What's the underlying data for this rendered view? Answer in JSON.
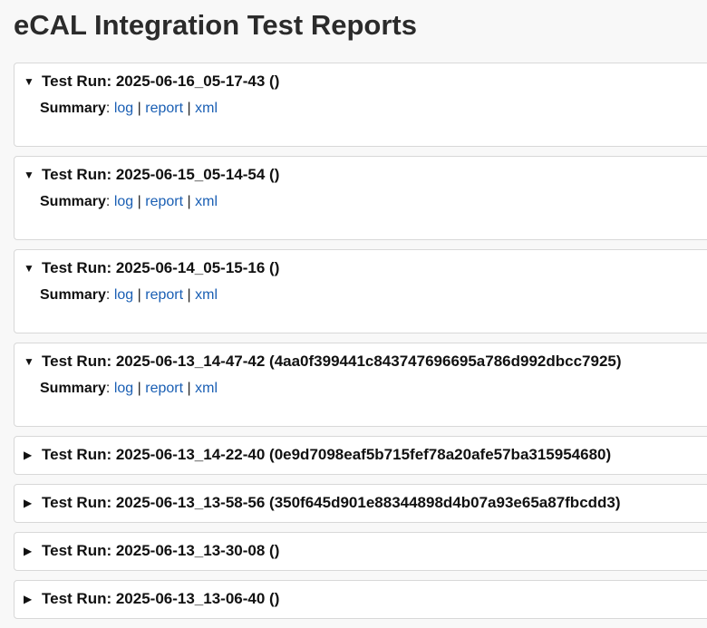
{
  "page": {
    "title": "eCAL Integration Test Reports"
  },
  "summary": {
    "label": "Summary",
    "colon": ":",
    "separator": "|",
    "links": [
      "log",
      "report",
      "xml"
    ]
  },
  "runs": [
    {
      "title": "Test Run: 2025-06-16_05-17-43 ()",
      "expanded": true
    },
    {
      "title": "Test Run: 2025-06-15_05-14-54 ()",
      "expanded": true
    },
    {
      "title": "Test Run: 2025-06-14_05-15-16 ()",
      "expanded": true
    },
    {
      "title": "Test Run: 2025-06-13_14-47-42 (4aa0f399441c843747696695a786d992dbcc7925)",
      "expanded": true
    },
    {
      "title": "Test Run: 2025-06-13_14-22-40 (0e9d7098eaf5b715fef78a20afe57ba315954680)",
      "expanded": false
    },
    {
      "title": "Test Run: 2025-06-13_13-58-56 (350f645d901e88344898d4b07a93e65a87fbcdd3)",
      "expanded": false
    },
    {
      "title": "Test Run: 2025-06-13_13-30-08 ()",
      "expanded": false
    },
    {
      "title": "Test Run: 2025-06-13_13-06-40 ()",
      "expanded": false
    }
  ]
}
